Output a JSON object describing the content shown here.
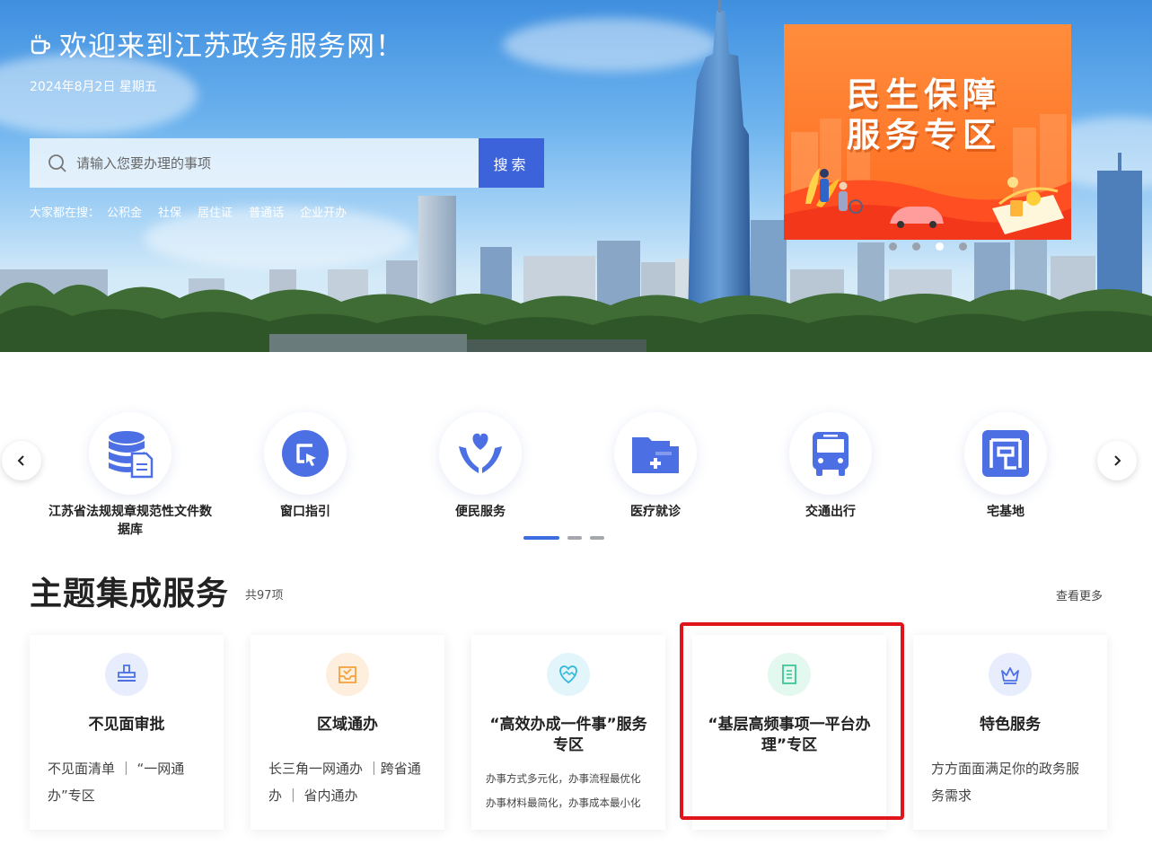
{
  "hero": {
    "welcome": "欢迎来到江苏政务服务网！",
    "date": "2024年8月2日 星期五",
    "search_placeholder": "请输入您要办理的事项",
    "search_button": "搜索",
    "hot_label": "大家都在搜：",
    "hot_items": [
      "公积金",
      "社保",
      "居住证",
      "普通话",
      "企业开办"
    ]
  },
  "banner": {
    "line1": "民生保障",
    "line2": "服务专区",
    "slide_count": 4,
    "active_slide": 3,
    "colors": {
      "bg": "#ff7a2c",
      "accent": "#ffcf5c"
    }
  },
  "services": [
    {
      "label": "江苏省法规规章规范性文件数据库",
      "icon": "database-document-icon"
    },
    {
      "label": "窗口指引",
      "icon": "window-guide-icon"
    },
    {
      "label": "便民服务",
      "icon": "heart-hands-icon"
    },
    {
      "label": "医疗就诊",
      "icon": "medical-folder-icon"
    },
    {
      "label": "交通出行",
      "icon": "bus-icon"
    },
    {
      "label": "宅基地",
      "icon": "homestead-icon"
    }
  ],
  "services_pager": {
    "pages": 3,
    "active": 1
  },
  "theme": {
    "title": "主题集成服务",
    "count": "共97项",
    "more": "查看更多",
    "cards": [
      {
        "title": "不见面审批",
        "desc": "不见面清单 ｜ “一网通办”专区",
        "icon": "stamp-icon"
      },
      {
        "title": "区域通办",
        "desc": "长三角一网通办 ｜跨省通办 ｜ 省内通办",
        "icon": "inbox-check-icon"
      },
      {
        "title": "“高效办成一件事”服务专区",
        "desc_lines": [
          "办事方式多元化，办事流程最优化",
          "办事材料最简化，办事成本最小化"
        ],
        "icon": "handshake-heart-icon"
      },
      {
        "title": "“基层高频事项一平台办理”专区",
        "desc": "",
        "icon": "document-list-icon"
      },
      {
        "title": "特色服务",
        "desc": "方方面面满足你的政务服务需求",
        "icon": "crown-icon"
      }
    ]
  },
  "colors": {
    "primary": "#3d63db",
    "icon_blue": "#4c70e4",
    "highlight": "#e0141b"
  }
}
